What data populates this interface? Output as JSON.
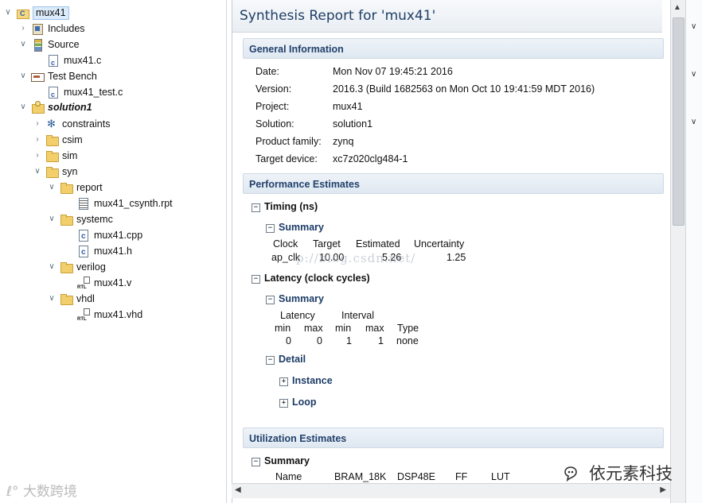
{
  "tree": {
    "items": [
      {
        "label": "mux41"
      },
      {
        "label": "Includes"
      },
      {
        "label": "Source"
      },
      {
        "label": "mux41.c"
      },
      {
        "label": "Test Bench"
      },
      {
        "label": "mux41_test.c"
      },
      {
        "label": "solution1"
      },
      {
        "label": "constraints"
      },
      {
        "label": "csim"
      },
      {
        "label": "sim"
      },
      {
        "label": "syn"
      },
      {
        "label": "report"
      },
      {
        "label": "mux41_csynth.rpt"
      },
      {
        "label": "systemc"
      },
      {
        "label": "mux41.cpp"
      },
      {
        "label": "mux41.h"
      },
      {
        "label": "verilog"
      },
      {
        "label": "mux41.v"
      },
      {
        "label": "vhdl"
      },
      {
        "label": "mux41.vhd"
      }
    ]
  },
  "report": {
    "title": "Synthesis Report for 'mux41'",
    "general": {
      "header": "General Information",
      "rows": [
        {
          "key": "Date:",
          "value": "Mon Nov 07 19:45:21 2016"
        },
        {
          "key": "Version:",
          "value": "2016.3 (Build 1682563 on Mon Oct 10 19:41:59 MDT 2016)"
        },
        {
          "key": "Project:",
          "value": "mux41"
        },
        {
          "key": "Solution:",
          "value": "solution1"
        },
        {
          "key": "Product family:",
          "value": "zynq"
        },
        {
          "key": "Target device:",
          "value": "xc7z020clg484-1"
        }
      ]
    },
    "performance": {
      "header": "Performance Estimates",
      "timing": {
        "title": "Timing (ns)",
        "summary": "Summary",
        "columns": [
          "Clock",
          "Target",
          "Estimated",
          "Uncertainty"
        ],
        "row": [
          "ap_clk",
          "10.00",
          "5.26",
          "1.25"
        ]
      },
      "latency": {
        "title": "Latency (clock cycles)",
        "summary": "Summary",
        "group_latency": "Latency",
        "group_interval": "Interval",
        "columns": [
          "min",
          "max",
          "min",
          "max",
          "Type"
        ],
        "row": [
          "0",
          "0",
          "1",
          "1",
          "none"
        ],
        "detail": "Detail",
        "instance": "Instance",
        "loop": "Loop"
      }
    },
    "utilization": {
      "header": "Utilization Estimates",
      "summary": "Summary",
      "columns": [
        "Name",
        "BRAM_18K",
        "DSP48E",
        "FF",
        "LUT"
      ]
    },
    "watermark": "p://blog.csdn.net/"
  },
  "logos": {
    "left": "大数跨境",
    "right": "依元素科技"
  }
}
